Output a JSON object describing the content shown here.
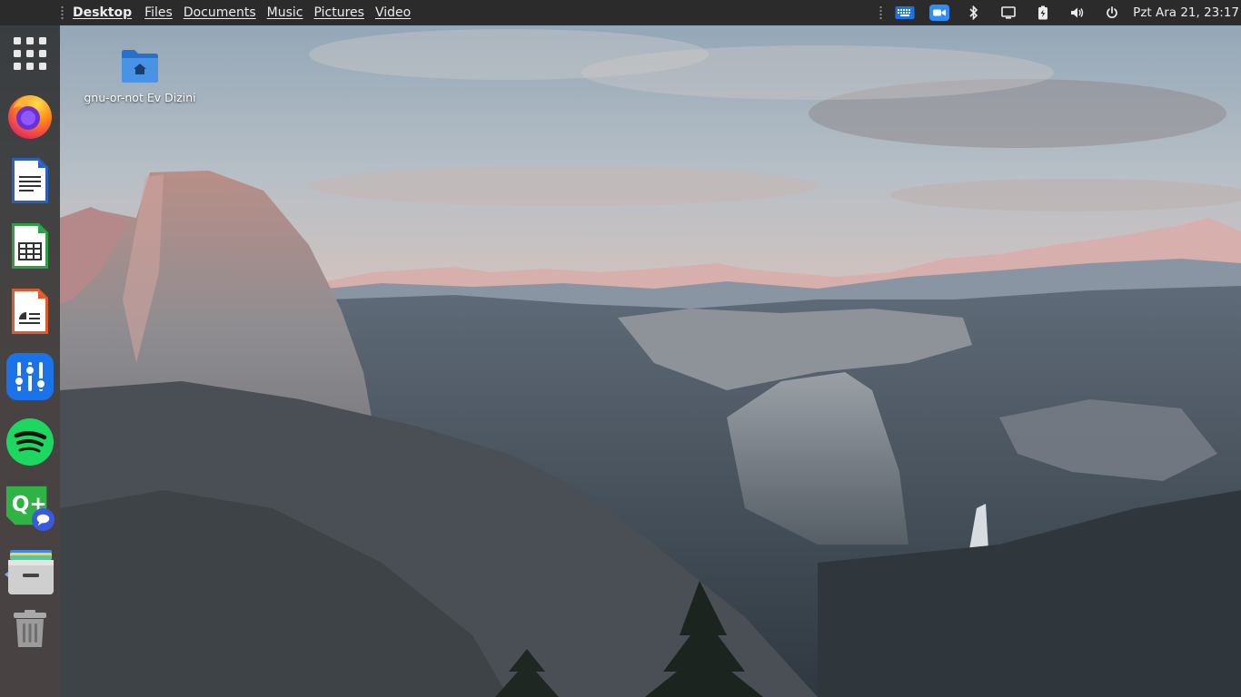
{
  "topbar": {
    "places": [
      {
        "label": "Desktop",
        "active": true
      },
      {
        "label": "Files"
      },
      {
        "label": "Documents"
      },
      {
        "label": "Music"
      },
      {
        "label": "Pictures"
      },
      {
        "label": "Video"
      }
    ],
    "tray_icons": [
      "keyboard-icon",
      "zoom-icon",
      "bluetooth-icon",
      "display-icon",
      "battery-icon",
      "volume-icon",
      "power-icon"
    ],
    "clock": "Pzt Ara 21, 23:17"
  },
  "dock": {
    "items": [
      "app-grid-icon",
      "firefox-icon",
      "libreoffice-writer-icon",
      "libreoffice-calc-icon",
      "libreoffice-impress-icon",
      "tweaks-icon",
      "spotify-icon",
      "qt-chat-icon",
      "files-manager-icon",
      "trash-icon"
    ]
  },
  "desktop": {
    "icon_label": "gnu-or-not Ev Dizini",
    "icon": "home-folder-icon"
  },
  "colors": {
    "topbar": "#2b2b2b",
    "accent_blue": "#1a73e8",
    "folder_blue": "#3584e4",
    "spotify_green": "#1ed760"
  }
}
